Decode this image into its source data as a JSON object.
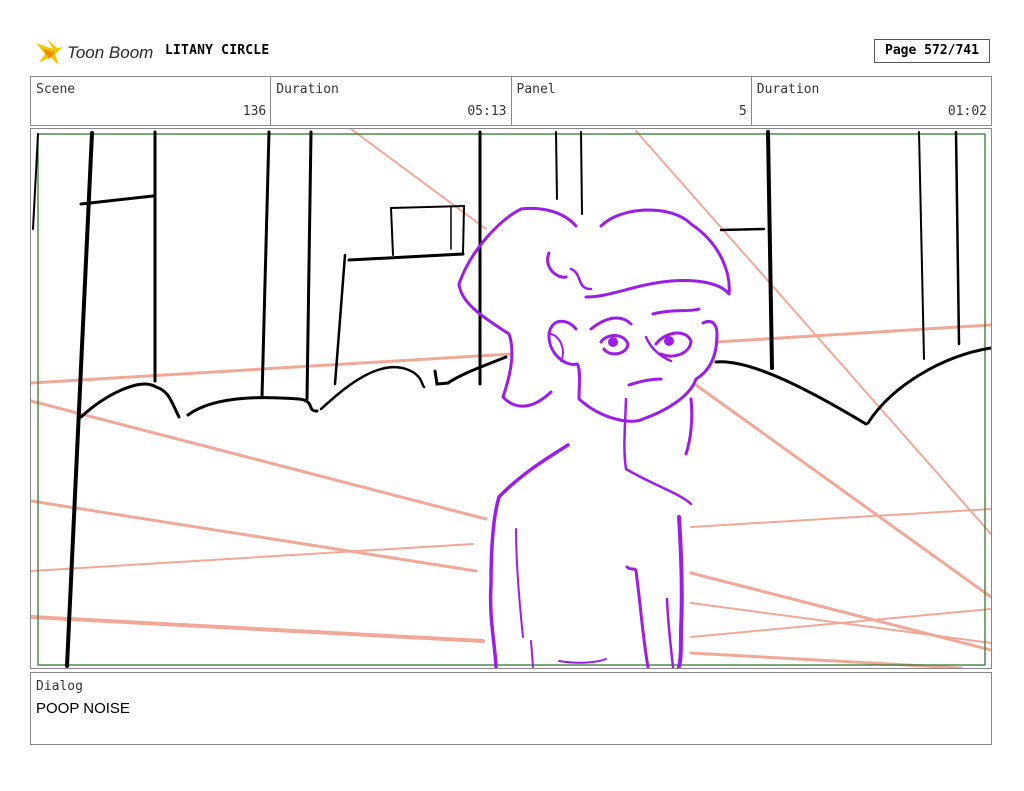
{
  "header": {
    "logo_text": "Toon Boom",
    "project_title": "LITANY CIRCLE",
    "page_label": "Page 572/741"
  },
  "info": {
    "scene_label": "Scene",
    "scene_value": "136",
    "duration_label": "Duration",
    "duration_value": "05:13",
    "panel_label": "Panel",
    "panel_value": "5",
    "panel_duration_label": "Duration",
    "panel_duration_value": "01:02"
  },
  "colors": {
    "guide_lines": "#f2a898",
    "character": "#9b1ee8",
    "safe_frame": "#2f7d2f",
    "background_ink": "#000000"
  },
  "dialog": {
    "label": "Dialog",
    "text": "POOP NOISE"
  }
}
